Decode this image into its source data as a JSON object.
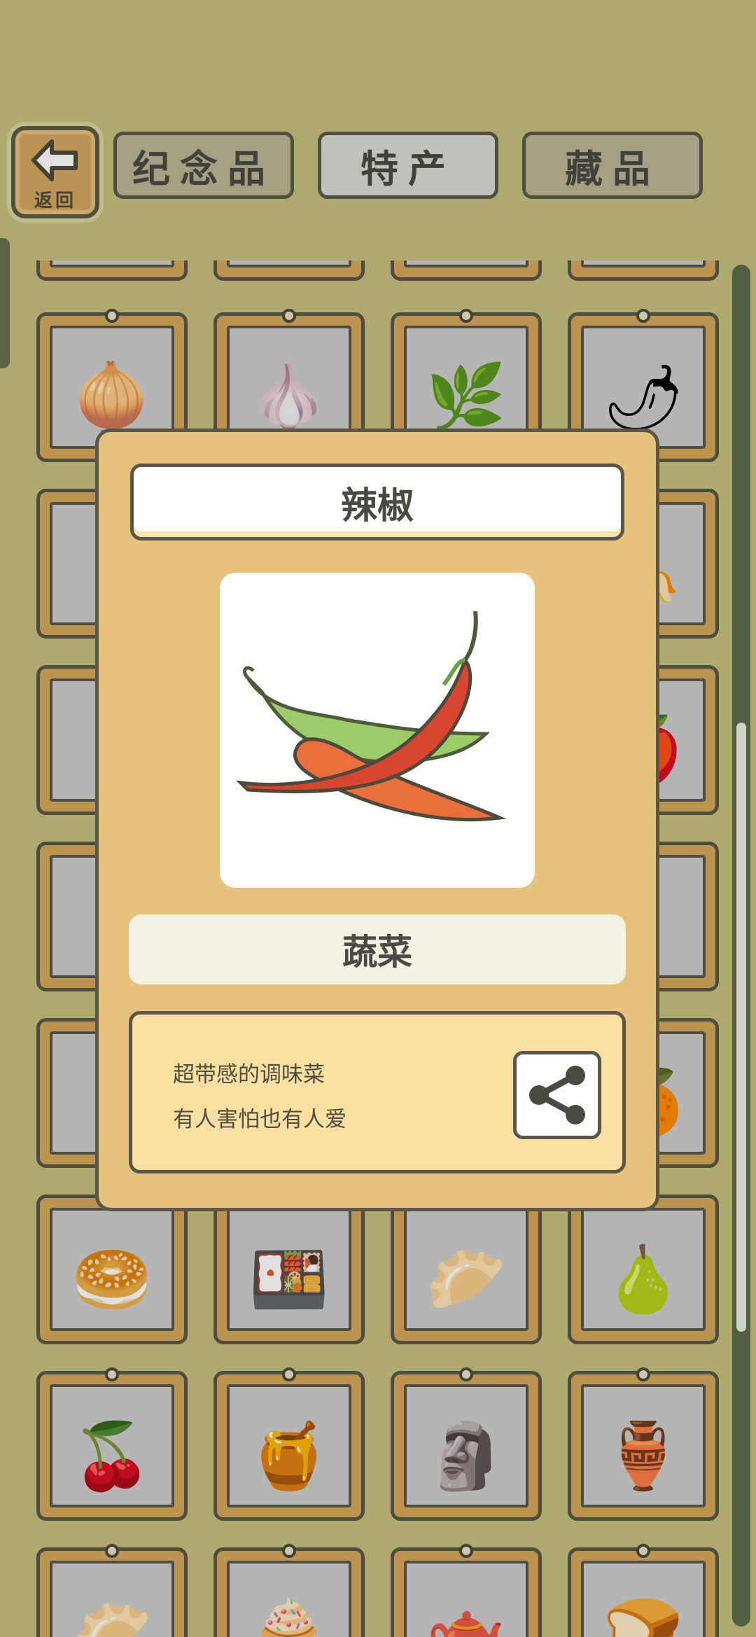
{
  "nav": {
    "back_label": "返回",
    "tabs": [
      {
        "label": "纪念品",
        "active": false
      },
      {
        "label": "特产",
        "active": true
      },
      {
        "label": "藏品",
        "active": false
      }
    ]
  },
  "grid": {
    "rows": [
      [
        "",
        "",
        "",
        ""
      ],
      [
        "onion",
        "garlic",
        "green-onion",
        "chili"
      ],
      [
        "",
        "",
        "",
        "banana"
      ],
      [
        "",
        "",
        "",
        "apple"
      ],
      [
        "",
        "",
        "",
        ""
      ],
      [
        "",
        "",
        "",
        "orange"
      ],
      [
        "bun",
        "bento",
        "dumpling-plate",
        "pear"
      ],
      [
        "cherry",
        "honey",
        "bronze-mask",
        "pink-mask"
      ],
      [
        "dumpling",
        "bun-blue",
        "kettle",
        "bread"
      ]
    ]
  },
  "detail": {
    "title": "辣椒",
    "image_icon": "chili-pepper-illustration",
    "category": "蔬菜",
    "description_lines": [
      "超带感的调味菜",
      "有人害怕也有人爱"
    ],
    "share_icon": "share-icon"
  },
  "colors": {
    "background": "#c6c27e",
    "card_wood": "#d7a85a",
    "popup_bg": "#e6c27d",
    "desc_bg": "#f9e0a0",
    "outline": "#5a574a"
  }
}
